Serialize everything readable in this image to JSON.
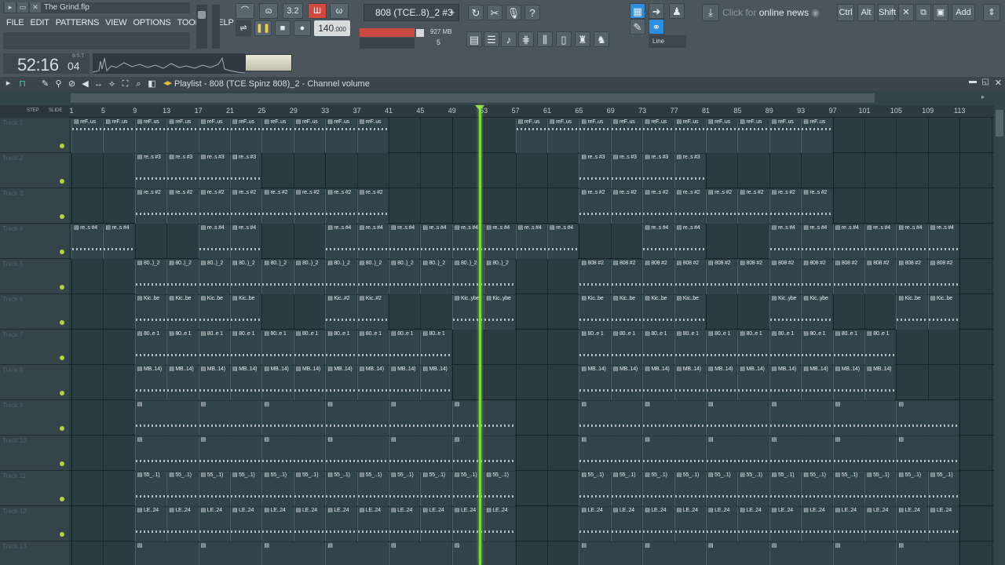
{
  "window": {
    "title": "The Grind.flp"
  },
  "menu": [
    "FILE",
    "EDIT",
    "PATTERNS",
    "VIEW",
    "OPTIONS",
    "TOOLS",
    "HELP"
  ],
  "transport": {
    "time_main": "52:16",
    "time_sub": "04",
    "time_tag": "B:S:T",
    "tempo": "140",
    "tempo_decimals": ".000",
    "pattern_name": "808 (TCE..8)_2 #3",
    "cpu_memory": "927 MB",
    "polyphony": "5",
    "record_mode_label": "3.2"
  },
  "news": {
    "prefix": "Click for",
    "text": "online news"
  },
  "toolbar_right": {
    "line_label": "Line",
    "ctrl": "Ctrl",
    "alt": "Alt",
    "shift": "Shift",
    "add": "Add"
  },
  "playlist": {
    "title": "Playlist - 808 (TCE Spinz 808)_2 - Channel volume",
    "step_label": "STEP",
    "slide_label": "SLIDE",
    "ruler_ticks": [
      "1",
      "5",
      "9",
      "13",
      "17",
      "21",
      "25",
      "29",
      "33",
      "37",
      "41",
      "45",
      "49",
      "53",
      "57",
      "61",
      "65",
      "69",
      "73",
      "77",
      "81",
      "85",
      "89",
      "93",
      "97",
      "101",
      "105",
      "109",
      "113"
    ],
    "playhead_bar": 52.5,
    "tracks": [
      {
        "name": "Track 1",
        "clips": [
          {
            "start": 1,
            "end": 41,
            "label": "reF..us",
            "every": 4
          },
          {
            "start": 57,
            "end": 97,
            "label": "reF..us",
            "every": 4
          }
        ]
      },
      {
        "name": "Track 2",
        "clips": [
          {
            "start": 9,
            "end": 25,
            "label": "re..s #3",
            "every": 4
          },
          {
            "start": 65,
            "end": 81,
            "label": "re..s #3",
            "every": 4
          }
        ]
      },
      {
        "name": "Track 3",
        "clips": [
          {
            "start": 9,
            "end": 41,
            "label": "re..s #2",
            "every": 4
          },
          {
            "start": 65,
            "end": 97,
            "label": "re..s #2",
            "every": 4
          }
        ]
      },
      {
        "name": "Track 4",
        "clips": [
          {
            "start": 1,
            "end": 9,
            "label": "re..s #4",
            "every": 4
          },
          {
            "start": 17,
            "end": 25,
            "label": "re..s #4",
            "every": 4
          },
          {
            "start": 33,
            "end": 65,
            "label": "re..s #4",
            "every": 4
          },
          {
            "start": 73,
            "end": 81,
            "label": "re..s #4",
            "every": 4
          },
          {
            "start": 89,
            "end": 113,
            "label": "re..s #4",
            "every": 4
          }
        ]
      },
      {
        "name": "Track 5",
        "clips": [
          {
            "start": 9,
            "end": 57,
            "label": "80..)_2",
            "every": 4
          },
          {
            "start": 65,
            "end": 113,
            "label": "808 #2",
            "every": 4
          }
        ]
      },
      {
        "name": "Track 6",
        "clips": [
          {
            "start": 9,
            "end": 25,
            "label": "Kic..be",
            "every": 4
          },
          {
            "start": 33,
            "end": 41,
            "label": "Kic..#2",
            "every": 4
          },
          {
            "start": 49,
            "end": 57,
            "label": "Kic..ybe",
            "every": 4
          },
          {
            "start": 65,
            "end": 81,
            "label": "Kic..be",
            "every": 4
          },
          {
            "start": 89,
            "end": 97,
            "label": "Kic..ybe",
            "every": 4
          },
          {
            "start": 105,
            "end": 113,
            "label": "Kic..be",
            "every": 4
          }
        ]
      },
      {
        "name": "Track 7",
        "clips": [
          {
            "start": 9,
            "end": 49,
            "label": "80..e 1",
            "every": 4
          },
          {
            "start": 65,
            "end": 105,
            "label": "80..e 1",
            "every": 4
          }
        ]
      },
      {
        "name": "Track 8",
        "clips": [
          {
            "start": 9,
            "end": 49,
            "label": "MB..14)",
            "every": 4
          },
          {
            "start": 65,
            "end": 105,
            "label": "MB..14)",
            "every": 4
          }
        ]
      },
      {
        "name": "Track 9",
        "clips": [
          {
            "start": 9,
            "end": 57,
            "label": "",
            "every": 8
          },
          {
            "start": 65,
            "end": 113,
            "label": "",
            "every": 8
          }
        ]
      },
      {
        "name": "Track 10",
        "clips": [
          {
            "start": 9,
            "end": 57,
            "label": "",
            "every": 8
          },
          {
            "start": 65,
            "end": 113,
            "label": "",
            "every": 8
          }
        ]
      },
      {
        "name": "Track 11",
        "clips": [
          {
            "start": 9,
            "end": 57,
            "label": "55_..1)",
            "every": 4
          },
          {
            "start": 65,
            "end": 113,
            "label": "55_..1)",
            "every": 4
          }
        ]
      },
      {
        "name": "Track 12",
        "clips": [
          {
            "start": 9,
            "end": 57,
            "label": "LE..24",
            "every": 4
          },
          {
            "start": 65,
            "end": 113,
            "label": "LE..24",
            "every": 4
          }
        ]
      },
      {
        "name": "Track 13",
        "clips": [
          {
            "start": 9,
            "end": 57,
            "label": "",
            "every": 8
          },
          {
            "start": 65,
            "end": 113,
            "label": "",
            "every": 8
          }
        ]
      }
    ]
  },
  "colors": {
    "playhead": "#7bd93d",
    "record": "#d24a3f",
    "accent_blue": "#2d8fe0",
    "led": "#b7d23a"
  },
  "icons": [
    "pattern-song-icon",
    "loop-icon",
    "record-icon",
    "metronome-icon",
    "play-icon",
    "stop-icon",
    "mixer-icon",
    "channel-rack-icon",
    "piano-roll-icon",
    "browser-icon",
    "plugin-icon",
    "news-icon",
    "close-icon",
    "maximize-icon",
    "minimize-icon"
  ]
}
